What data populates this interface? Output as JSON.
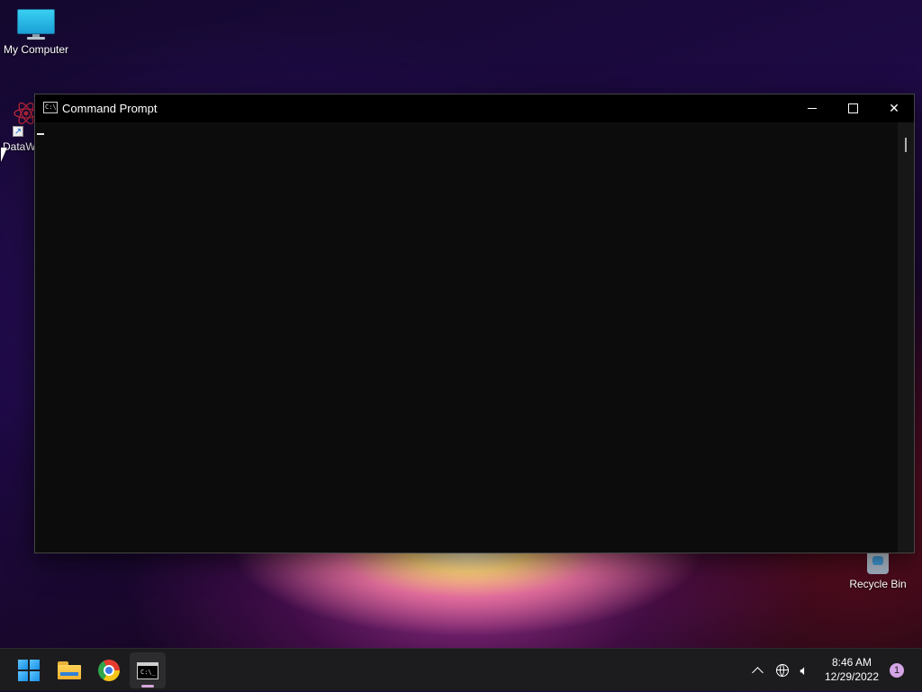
{
  "desktop": {
    "icons": [
      {
        "label": "My Computer",
        "icon": "monitor-icon"
      },
      {
        "label": "DataW",
        "icon": "atom-shortcut-icon"
      },
      {
        "label": "Recycle Bin",
        "icon": "recycle-bin-icon"
      }
    ]
  },
  "window": {
    "title": "Command Prompt",
    "app_icon_text": "C:\\",
    "buttons": {
      "minimize": "minimize",
      "maximize": "maximize",
      "close": "✕"
    }
  },
  "taskbar": {
    "apps": [
      {
        "name": "Start",
        "icon": "windows-logo-icon"
      },
      {
        "name": "File Explorer",
        "icon": "folder-icon"
      },
      {
        "name": "Google Chrome",
        "icon": "chrome-icon"
      },
      {
        "name": "Command Prompt",
        "icon": "cmd-icon",
        "active": true
      }
    ],
    "tray": {
      "chevron": "^",
      "time": "8:46 AM",
      "date": "12/29/2022",
      "notification_count": "1"
    }
  }
}
